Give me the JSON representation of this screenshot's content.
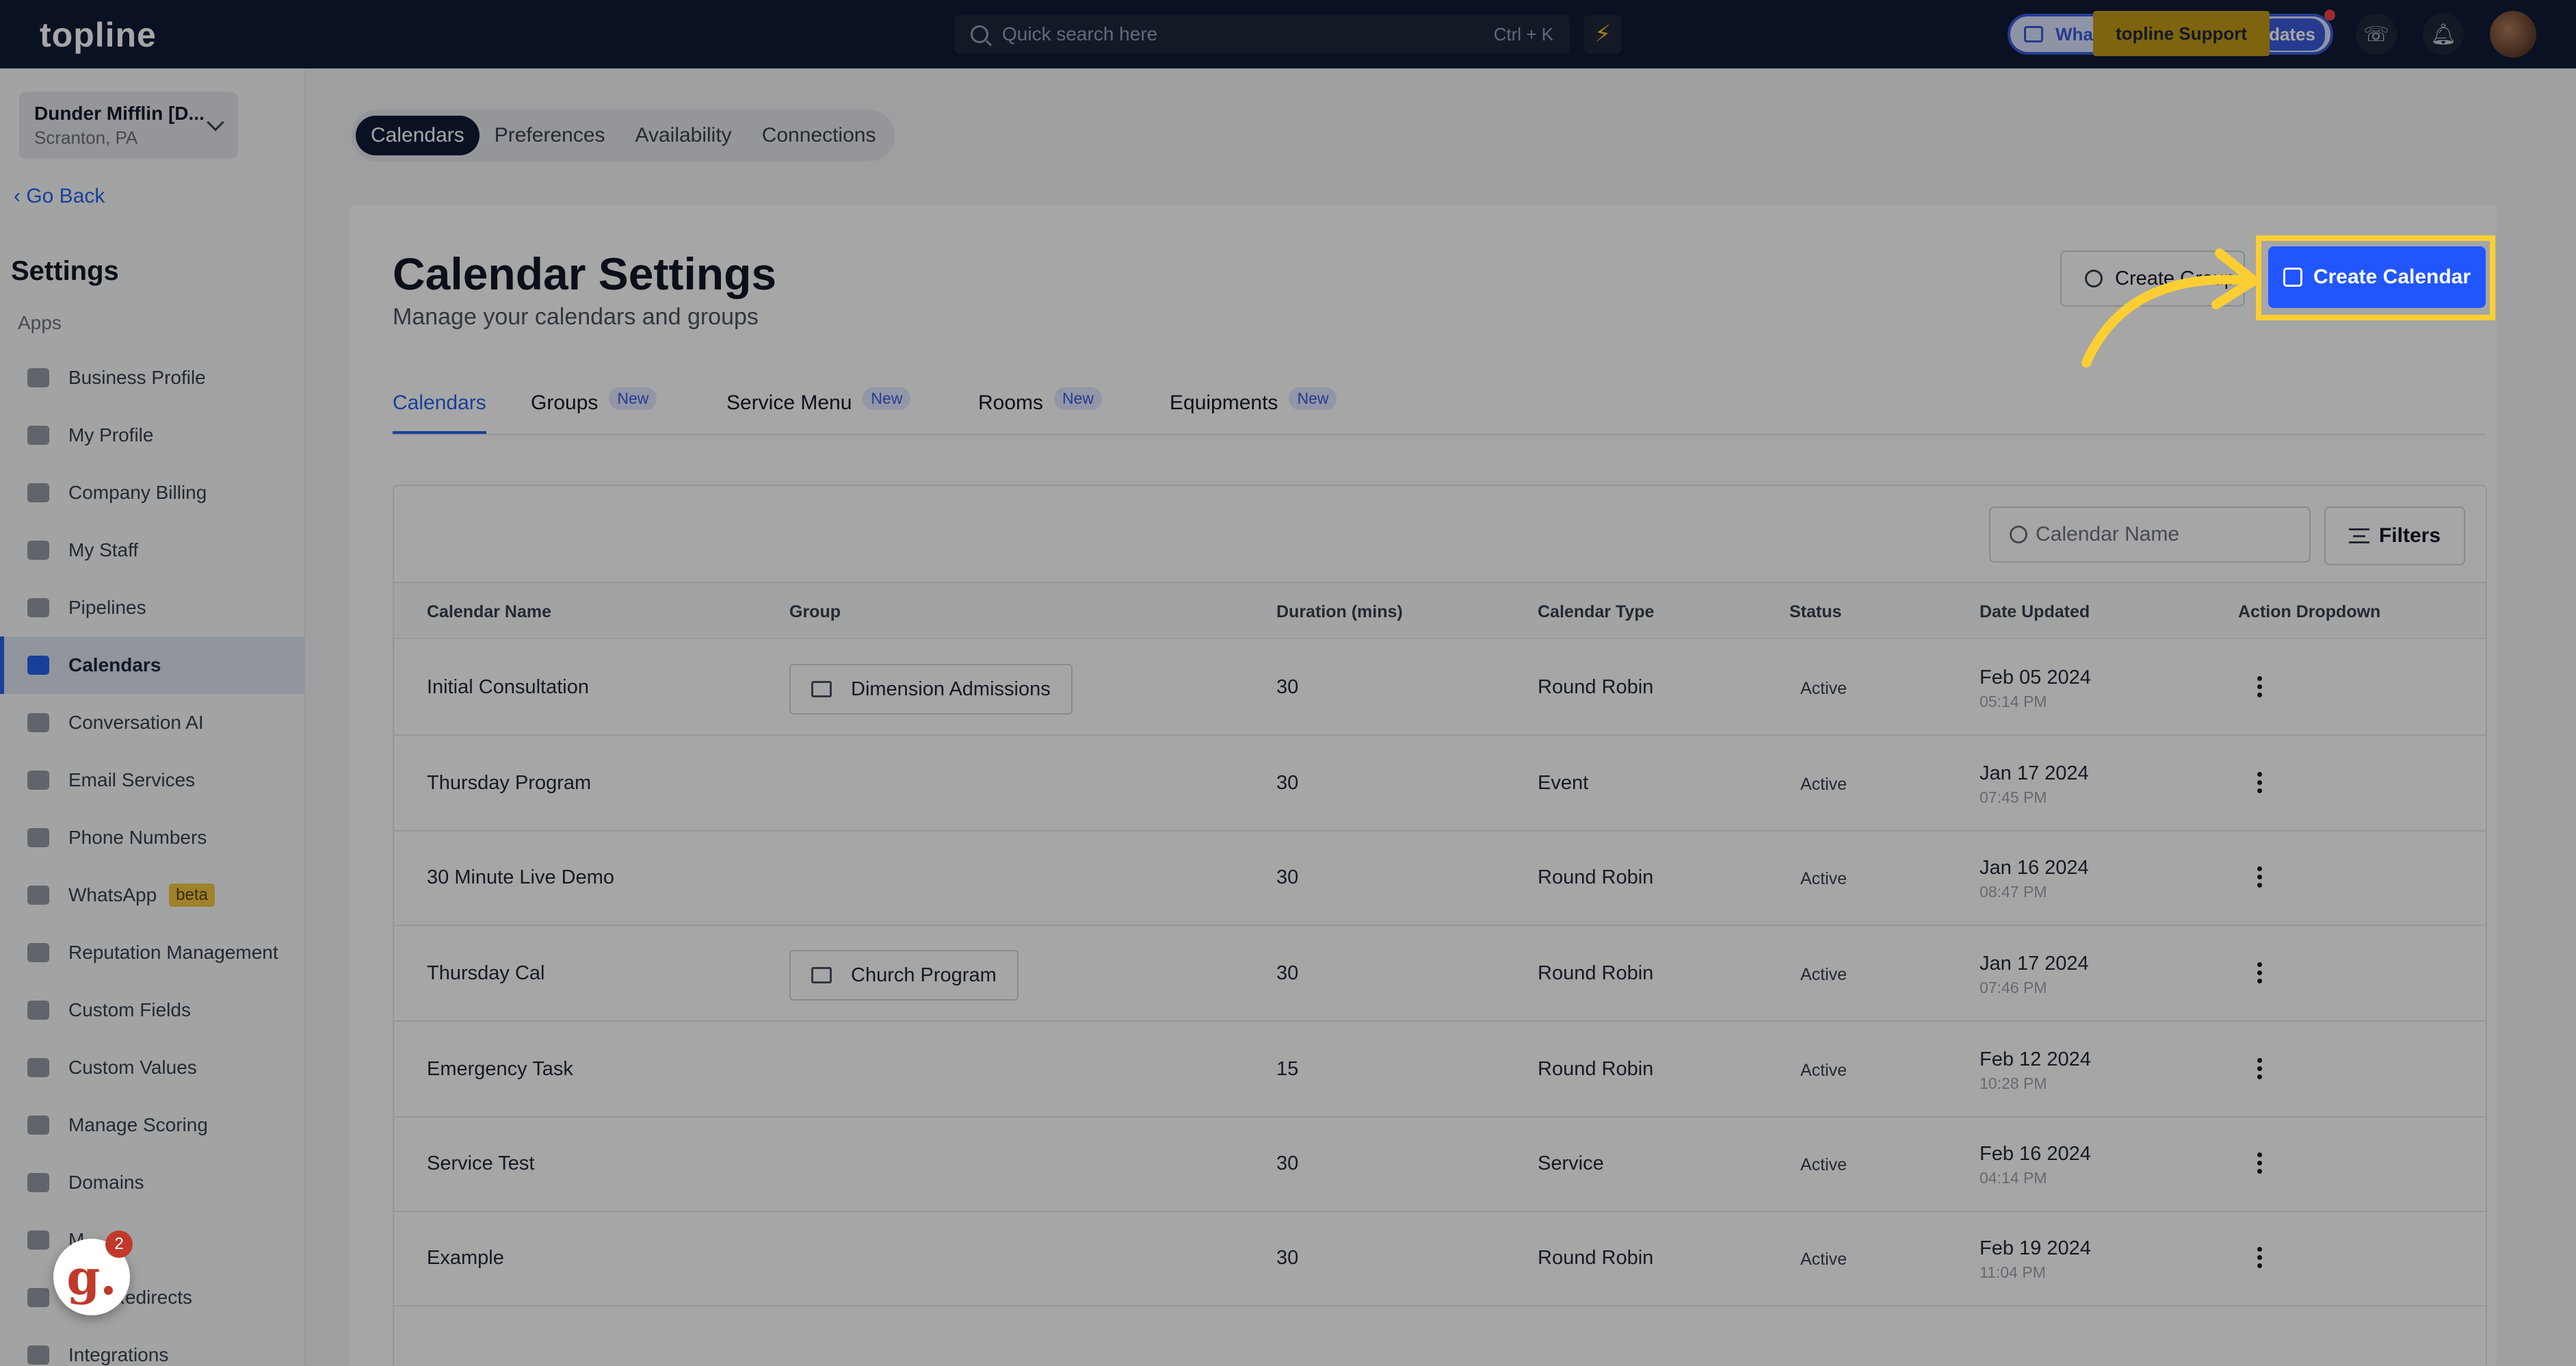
{
  "topbar": {
    "logo": "topline",
    "search_placeholder": "Quick search here",
    "search_shortcut": "Ctrl + K",
    "whats_new_start": "What",
    "whats_new_end": "dates",
    "support_label": "topline Support"
  },
  "sidebar": {
    "company_name": "Dunder Mifflin [D...",
    "company_location": "Scranton, PA",
    "go_back": "Go Back",
    "settings_title": "Settings",
    "section_label": "Apps",
    "items": [
      {
        "label": "Business Profile",
        "icon": "briefcase-icon"
      },
      {
        "label": "My Profile",
        "icon": "user-icon"
      },
      {
        "label": "Company Billing",
        "icon": "grid-icon"
      },
      {
        "label": "My Staff",
        "icon": "staff-icon"
      },
      {
        "label": "Pipelines",
        "icon": "pipeline-icon"
      },
      {
        "label": "Calendars",
        "icon": "calendar-icon",
        "active": true
      },
      {
        "label": "Conversation AI",
        "icon": "chat-icon"
      },
      {
        "label": "Email Services",
        "icon": "mail-icon"
      },
      {
        "label": "Phone Numbers",
        "icon": "phone-icon"
      },
      {
        "label": "WhatsApp",
        "icon": "whatsapp-icon",
        "badge": "beta"
      },
      {
        "label": "Reputation Management",
        "icon": "star-icon"
      },
      {
        "label": "Custom Fields",
        "icon": "fields-icon"
      },
      {
        "label": "Custom Values",
        "icon": "values-icon"
      },
      {
        "label": "Manage Scoring",
        "icon": "scoring-icon"
      },
      {
        "label": "Domains",
        "icon": "domain-icon"
      },
      {
        "label": "M...",
        "icon": "video-icon"
      },
      {
        "label": "URL Redirects",
        "icon": "link-icon"
      },
      {
        "label": "Integrations",
        "icon": "integrations-icon"
      }
    ],
    "chat_badge_count": "2",
    "chat_logo": "g."
  },
  "top_tabs": [
    "Calendars",
    "Preferences",
    "Availability",
    "Connections"
  ],
  "page": {
    "title": "Calendar Settings",
    "subtitle": "Manage your calendars and groups",
    "create_group_label": "Create Group",
    "create_calendar_label": "Create Calendar",
    "highlight_color": "#fbcf33",
    "primary_color": "#2156ff"
  },
  "sub_tabs": [
    {
      "label": "Calendars",
      "badge": ""
    },
    {
      "label": "Groups",
      "badge": "New"
    },
    {
      "label": "Service Menu",
      "badge": "New"
    },
    {
      "label": "Rooms",
      "badge": "New"
    },
    {
      "label": "Equipments",
      "badge": "New"
    }
  ],
  "table": {
    "search_placeholder": "Calendar Name",
    "filters_label": "Filters",
    "columns": [
      "Calendar Name",
      "Group",
      "Duration (mins)",
      "Calendar Type",
      "Status",
      "Date Updated",
      "Action Dropdown"
    ],
    "rows": [
      {
        "name": "Initial Consultation",
        "group": "Dimension Admissions",
        "duration": "30",
        "type": "Round Robin",
        "status": "Active",
        "date": "Feb 05 2024",
        "time": "05:14 PM"
      },
      {
        "name": "Thursday Program",
        "group": "",
        "duration": "30",
        "type": "Event",
        "status": "Active",
        "date": "Jan 17 2024",
        "time": "07:45 PM"
      },
      {
        "name": "30 Minute Live Demo",
        "group": "",
        "duration": "30",
        "type": "Round Robin",
        "status": "Active",
        "date": "Jan 16 2024",
        "time": "08:47 PM"
      },
      {
        "name": "Thursday Cal",
        "group": "Church Program",
        "duration": "30",
        "type": "Round Robin",
        "status": "Active",
        "date": "Jan 17 2024",
        "time": "07:46 PM"
      },
      {
        "name": "Emergency Task",
        "group": "",
        "duration": "15",
        "type": "Round Robin",
        "status": "Active",
        "date": "Feb 12 2024",
        "time": "10:28 PM"
      },
      {
        "name": "Service Test",
        "group": "",
        "duration": "30",
        "type": "Service",
        "status": "Active",
        "date": "Feb 16 2024",
        "time": "04:14 PM"
      },
      {
        "name": "Example",
        "group": "",
        "duration": "30",
        "type": "Round Robin",
        "status": "Active",
        "date": "Feb 19 2024",
        "time": "11:04 PM"
      }
    ]
  }
}
